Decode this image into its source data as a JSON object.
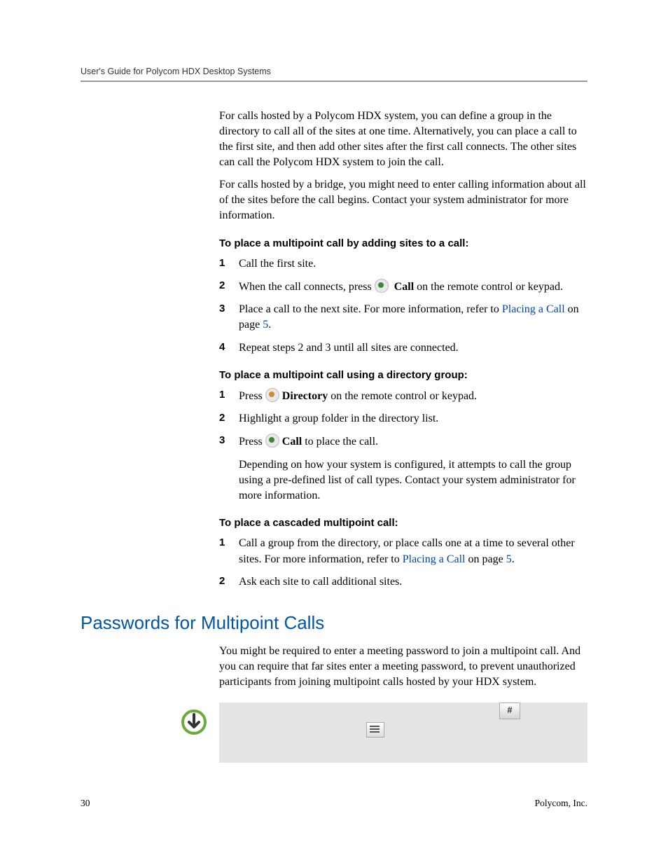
{
  "header": {
    "running_title": "User's Guide for Polycom HDX Desktop Systems"
  },
  "intro": {
    "para1": "For calls hosted by a Polycom HDX system, you can define a group in the directory to call all of the sites at one time. Alternatively, you can place a call to the first site, and then add other sites after the first call connects. The other sites can call the Polycom HDX system to join the call.",
    "para2": "For calls hosted by a bridge, you might need to enter calling information about all of the sites before the call begins. Contact your system administrator for more information."
  },
  "proc1": {
    "heading": "To place a multipoint call by adding sites to a call:",
    "step1": "Call the first site.",
    "step2_a": "When the call connects, press ",
    "step2_call": "Call",
    "step2_b": " on the remote control or keypad.",
    "step3_a": "Place a call to the next site. For more information, refer to ",
    "step3_link": "Placing a Call",
    "step3_b": " on page ",
    "step3_page": "5",
    "step3_c": ".",
    "step4": "Repeat steps 2 and 3 until all sites are connected."
  },
  "proc2": {
    "heading": "To place a multipoint call using a directory group:",
    "step1_a": "Press ",
    "step1_dir": "Directory",
    "step1_b": " on the remote control or keypad.",
    "step2": "Highlight a group folder in the directory list.",
    "step3_a": "Press ",
    "step3_call": "Call",
    "step3_b": " to place the call.",
    "step3_note": "Depending on how your system is configured, it attempts to call the group using a pre-defined list of call types. Contact your system administrator for more information."
  },
  "proc3": {
    "heading": "To place a cascaded multipoint call:",
    "step1_a": "Call a group from the directory, or place calls one at a time to several other sites. For more information, refer to ",
    "step1_link": "Placing a Call",
    "step1_b": " on page ",
    "step1_page": "5",
    "step1_c": ".",
    "step2": "Ask each site to call additional sites."
  },
  "section": {
    "h2": "Passwords for Multipoint Calls",
    "para": "You might be required to enter a meeting password to join a multipoint call. And you can require that far sites enter a meeting password, to prevent unauthorized participants from joining multipoint calls hosted by your HDX system."
  },
  "note": {
    "hash": "#"
  },
  "footer": {
    "page": "30",
    "company": "Polycom, Inc."
  }
}
